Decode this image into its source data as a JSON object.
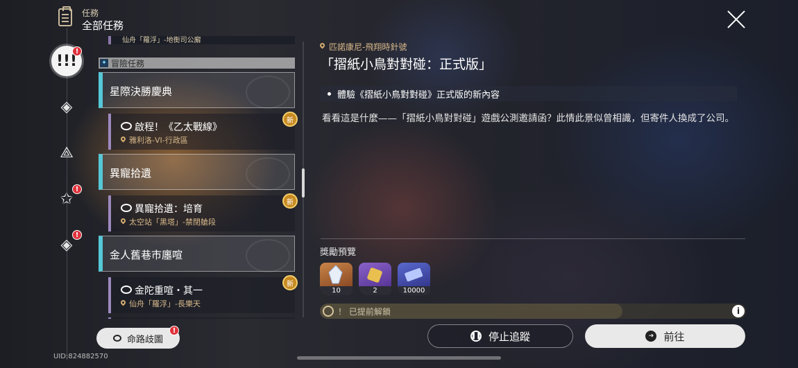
{
  "header": {
    "section_label": "任務",
    "title": "全部任務"
  },
  "rail": {
    "badge_text": "!"
  },
  "list": {
    "partial_location": "仙舟「羅浮」-地衡司公廨",
    "category": "冒險任務",
    "groups": [
      {
        "title": "星際決勝慶典",
        "quest": {
          "title": "啟程！《乙太戰線》",
          "location": "雅利洛-VI-行政區",
          "new_label": "新"
        }
      },
      {
        "title": "異寵拾遺",
        "quest": {
          "title": "異寵拾遺：培育",
          "location": "太空站「黑塔」-禁閉艙段",
          "new_label": "新"
        }
      },
      {
        "title": "金人舊巷市廛喧",
        "quest": {
          "title": "金陀重喧・其一",
          "location": "仙舟「羅浮」-長樂天",
          "new_label": "新"
        }
      }
    ]
  },
  "map_button": {
    "label": "命路歧圖"
  },
  "uid": "UID:824882570",
  "detail": {
    "location": "匹諾康尼-飛翔時針號",
    "title": "「摺紙小鳥對對碰：正式版」",
    "objective": "體驗《摺紙小鳥對對碰》正式版的新內容",
    "description": "看看這是什麼——「摺紙小鳥對對碰」遊戲公測邀請函？此情此景似曾相識，但寄件人換成了公司。",
    "rewards_label": "獎勵預覽",
    "rewards": [
      {
        "icon": "crystal-icon",
        "count": "10",
        "color": "#b06a3a"
      },
      {
        "icon": "gold-item-icon",
        "count": "2",
        "color": "#6a4aa8"
      },
      {
        "icon": "credit-icon",
        "count": "10000",
        "color": "#4a58b8"
      }
    ],
    "unlock_text": "！ 已提前解鎖",
    "unlock_progress_pct": 71,
    "info_label": "i"
  },
  "actions": {
    "stop_label": "停止追蹤",
    "go_label": "前往"
  }
}
